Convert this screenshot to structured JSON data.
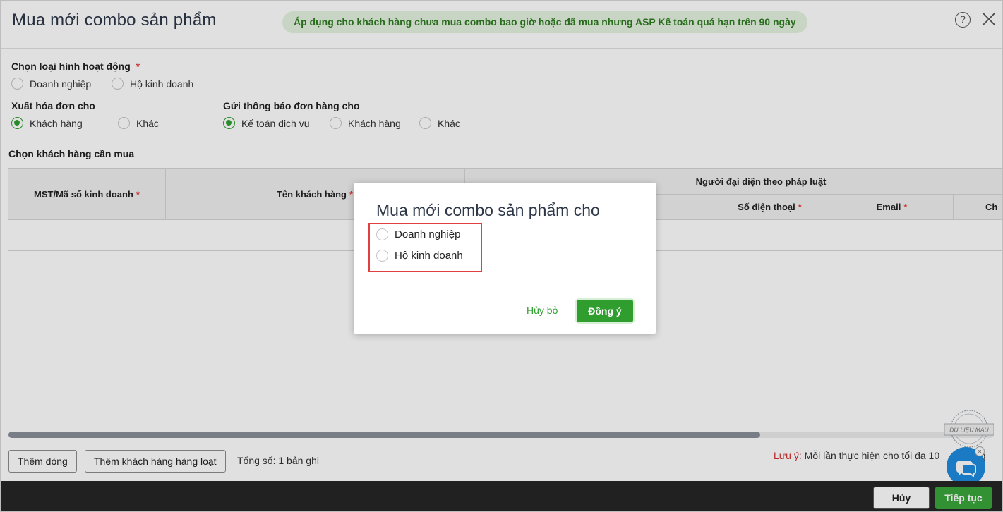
{
  "header": {
    "title": "Mua mới combo sản phẩm",
    "notice": "Áp dụng cho khách hàng chưa mua combo bao giờ hoặc đã mua nhưng ASP Kế toán quá hạn trên 90 ngày",
    "help_glyph": "?"
  },
  "form": {
    "activity_type": {
      "label": "Chọn loại hình hoạt động",
      "required_mark": "*",
      "options": [
        "Doanh nghiệp",
        "Hộ kinh doanh"
      ],
      "selected": null
    },
    "invoice_for": {
      "label": "Xuất hóa đơn cho",
      "options": [
        "Khách hàng",
        "Khác"
      ],
      "selected": "Khách hàng"
    },
    "notify_to": {
      "label": "Gửi thông báo đơn hàng cho",
      "options": [
        "Kế toán dịch vụ",
        "Khách hàng",
        "Khác"
      ],
      "selected": "Kế toán dịch vụ"
    }
  },
  "customers": {
    "section_title": "Chọn khách hàng cần mua",
    "columns": {
      "tax_code": "MST/Mã số kinh doanh",
      "customer_name": "Tên khách hàng",
      "legal_rep_group": "Người đại diện theo pháp luật",
      "phone": "Số điện thoại",
      "email": "Email",
      "partial_col": "Ch"
    },
    "required_mark": "*",
    "rows": [
      {
        "tax_code": "",
        "customer_name": "",
        "phone": "",
        "email": ""
      }
    ]
  },
  "bottom": {
    "add_row": "Thêm dòng",
    "add_bulk": "Thêm khách hàng hàng loạt",
    "total": "Tổng số: 1 bản ghi",
    "note_label": "Lưu ý:",
    "note_text": "Mỗi lần thực hiện cho tối đa 10",
    "note_tail": "ng",
    "stamp": "DỮ LIỆU MẪU",
    "chat_close": "×"
  },
  "footer": {
    "cancel": "Hủy",
    "next": "Tiếp tục"
  },
  "modal": {
    "title": "Mua mới combo sản phẩm cho",
    "options": [
      "Doanh nghiệp",
      "Hộ kinh doanh"
    ],
    "selected": null,
    "cancel": "Hủy bỏ",
    "ok": "Đồng ý"
  },
  "colors": {
    "accent_green": "#2f9e2f",
    "notice_bg": "#e4f3e0",
    "highlight_red": "#e04040",
    "chat_blue": "#1e8be0",
    "footer_dark": "#262626"
  }
}
